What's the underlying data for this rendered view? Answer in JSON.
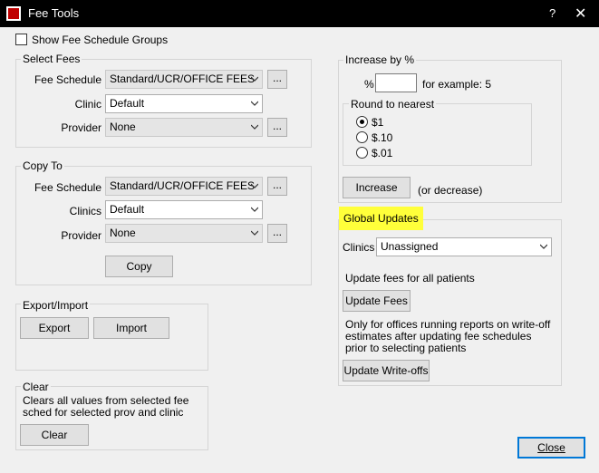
{
  "window": {
    "title": "Fee Tools",
    "help": "?",
    "close": "✕"
  },
  "show_groups_label": "Show Fee Schedule Groups",
  "select_fees": {
    "title": "Select Fees",
    "fee_schedule_label": "Fee Schedule",
    "fee_schedule_value": "Standard/UCR/OFFICE FEES",
    "clinic_label": "Clinic",
    "clinic_value": "Default",
    "provider_label": "Provider",
    "provider_value": "None",
    "ellipsis": "..."
  },
  "copy_to": {
    "title": "Copy To",
    "fee_schedule_label": "Fee Schedule",
    "fee_schedule_value": "Standard/UCR/OFFICE FEES",
    "clinics_label": "Clinics",
    "clinics_value": "Default",
    "provider_label": "Provider",
    "provider_value": "None",
    "ellipsis": "...",
    "copy_button": "Copy"
  },
  "export_import": {
    "title": "Export/Import",
    "export_button": "Export",
    "import_button": "Import"
  },
  "clear": {
    "title": "Clear",
    "description": "Clears all values from selected fee sched for selected prov and clinic",
    "clear_button": "Clear"
  },
  "increase": {
    "title": "Increase by %",
    "percent_symbol": "%",
    "percent_value": "",
    "example": "for example: 5",
    "round_title": "Round to nearest",
    "round_options": [
      "$1",
      "$.10",
      "$.01"
    ],
    "round_selected": 0,
    "increase_button": "Increase",
    "or_decrease": "(or decrease)"
  },
  "global_updates": {
    "title": "Global Updates",
    "clinics_label": "Clinics",
    "clinics_value": "Unassigned",
    "update_all_text": "Update fees for all patients",
    "update_fees_button": "Update Fees",
    "writeoff_text": "Only for offices running reports on write-off estimates after updating fee schedules prior to selecting patients",
    "update_writeoffs_button": "Update Write-offs",
    "highlight_color": "#ffff3a"
  },
  "close_button": "Close"
}
